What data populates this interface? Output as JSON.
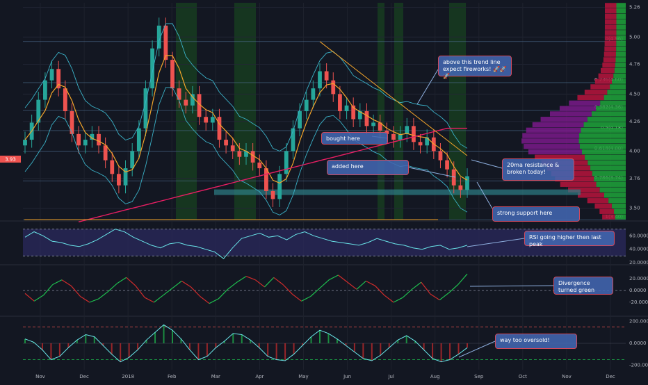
{
  "colors": {
    "background": "#131722",
    "up": "#26a69a",
    "down": "#ef5350",
    "bollinger": "#3bb3c9",
    "ma20": "#f4a52a",
    "ma200": "#e91e63",
    "rsi_line": "#6ae6ea",
    "rsi_band": "#2b2a5e",
    "support_zone": "#2e7f86",
    "osc_up": "#1fbf4f",
    "osc_down": "#d12c2c",
    "volume_profile_up": "#1fa43a",
    "volume_profile_down": "#b8143c",
    "volume_profile_value_area": "#7a1a8a",
    "highlight_band": "#1b5e20",
    "annotation_box": "#4266b0",
    "annotation_border": "#d04a5e",
    "trendline": "#f4a52a"
  },
  "chart_data": [
    {
      "type": "candlestick",
      "ylim": [
        3.4,
        5.3
      ],
      "ylim_note": "price axis",
      "x_tick_labels": [
        "Nov",
        "Dec",
        "2018",
        "Feb",
        "Mar",
        "Apr",
        "May",
        "Jun",
        "Jul",
        "Aug",
        "Sep",
        "Oct",
        "Nov",
        "Dec"
      ],
      "y_tick_labels": [
        "5.26",
        "5.00",
        "4.76",
        "4.50",
        "4.26",
        "4.00",
        "3.76",
        "3.50"
      ],
      "current_price_label": "3.93",
      "close_series": [
        4.1,
        4.25,
        4.45,
        4.62,
        4.72,
        4.55,
        4.35,
        4.15,
        4.05,
        4.1,
        4.15,
        4.05,
        3.92,
        3.8,
        3.7,
        3.85,
        4.0,
        4.2,
        4.55,
        4.9,
        5.1,
        4.8,
        4.55,
        4.45,
        4.4,
        4.5,
        4.3,
        4.25,
        4.3,
        4.1,
        4.05,
        4.0,
        3.95,
        4.0,
        3.9,
        3.85,
        3.65,
        3.58,
        3.8,
        4.0,
        4.2,
        4.35,
        4.45,
        4.55,
        4.7,
        4.62,
        4.5,
        4.35,
        4.4,
        4.28,
        4.35,
        4.22,
        4.25,
        4.18,
        4.15,
        4.1,
        4.15,
        4.22,
        4.08,
        4.05,
        4.12,
        4.0,
        3.92,
        3.84,
        3.7,
        3.66,
        3.78
      ],
      "fib_levels": [
        {
          "label": "0(4.96)",
          "value": 4.96
        },
        {
          "label": "0.236(4.60)",
          "value": 4.6
        },
        {
          "label": "0.382(4.36)",
          "value": 4.36
        },
        {
          "label": "0.5(4.18)",
          "value": 4.18
        },
        {
          "label": "0.618(4.00)",
          "value": 4.0
        },
        {
          "label": "0.786(3.74)",
          "value": 3.74
        },
        {
          "label": "1(3.40)",
          "value": 3.4
        }
      ],
      "annotations": [
        {
          "text": "above this trend line expect fireworks! 🚀🚀🚀"
        },
        {
          "text": "bought here"
        },
        {
          "text": "added here"
        },
        {
          "text": "20ma resistance & broken today!"
        },
        {
          "text": "strong support here"
        }
      ]
    },
    {
      "type": "line",
      "name": "RSI",
      "ylim": [
        20,
        80
      ],
      "y_tick_labels": [
        "60.0000",
        "40.0000",
        "20.0000"
      ],
      "band": [
        30,
        70
      ],
      "values": [
        58,
        66,
        60,
        52,
        50,
        46,
        44,
        48,
        54,
        62,
        70,
        66,
        58,
        52,
        46,
        42,
        48,
        50,
        46,
        44,
        40,
        36,
        26,
        42,
        56,
        60,
        64,
        58,
        60,
        54,
        62,
        66,
        60,
        56,
        52,
        50,
        48,
        46,
        50,
        56,
        52,
        48,
        46,
        42,
        40,
        44,
        46,
        40,
        42,
        46
      ],
      "annotation": "RSI going higher then last peak"
    },
    {
      "type": "line",
      "name": "oscillator",
      "ylim": [
        -40,
        40
      ],
      "y_tick_labels": [
        "20.0000",
        "0.0000",
        "-20.0000"
      ],
      "values": [
        -5,
        -18,
        -8,
        10,
        18,
        8,
        -10,
        -20,
        -14,
        -2,
        12,
        22,
        8,
        -12,
        -20,
        -8,
        4,
        16,
        6,
        -10,
        -22,
        -14,
        2,
        14,
        24,
        18,
        6,
        22,
        10,
        -6,
        -18,
        -10,
        4,
        18,
        26,
        14,
        2,
        16,
        8,
        -8,
        -20,
        -12,
        2,
        14,
        -6,
        -16,
        -4,
        10,
        28
      ],
      "annotation": "Divergence turned green"
    },
    {
      "type": "area",
      "name": "momentum",
      "ylim": [
        -230,
        230
      ],
      "y_tick_labels": [
        "200.0000",
        "0.0000",
        "-200.0000"
      ],
      "reference_lines": [
        150,
        -150
      ],
      "values": [
        40,
        10,
        -60,
        -150,
        -120,
        -40,
        30,
        80,
        60,
        -20,
        -100,
        -170,
        -130,
        -60,
        30,
        100,
        170,
        120,
        40,
        -60,
        -150,
        -120,
        -40,
        20,
        90,
        80,
        30,
        -40,
        -120,
        -150,
        -160,
        -100,
        -20,
        60,
        120,
        90,
        40,
        -20,
        -80,
        -140,
        -160,
        -110,
        -40,
        30,
        70,
        20,
        -60,
        -140,
        -170,
        -150,
        -100,
        -40
      ],
      "annotation": "way too oversold!"
    }
  ]
}
